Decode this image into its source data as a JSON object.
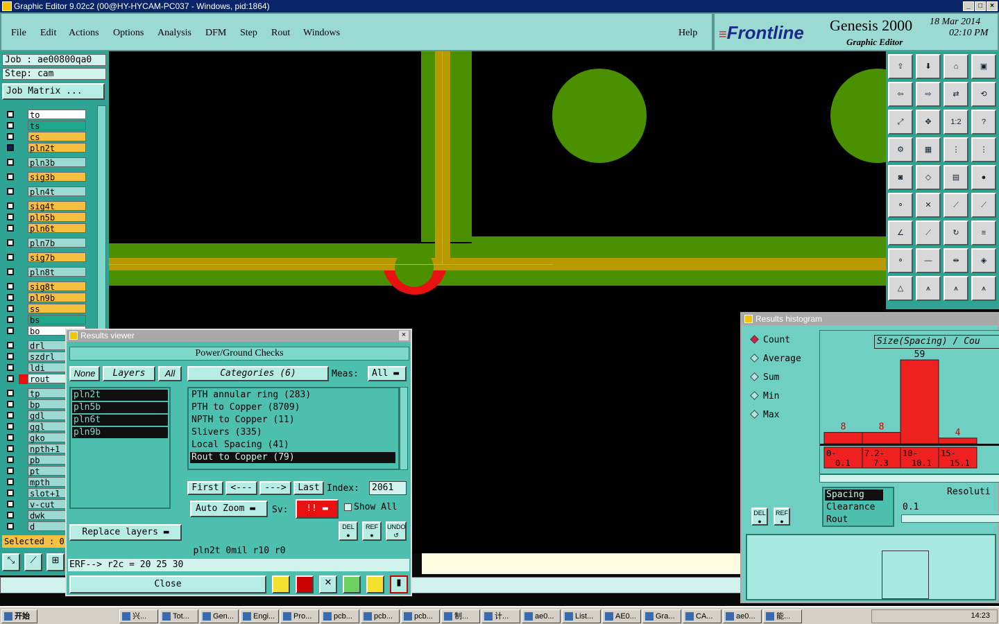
{
  "window": {
    "title": "Graphic Editor 9.02c2 (00@HY-HYCAM-PC037 - Windows, pid:1864)"
  },
  "menu": [
    "File",
    "Edit",
    "Actions",
    "Options",
    "Analysis",
    "DFM",
    "Step",
    "Rout",
    "Windows"
  ],
  "menu_help": "Help",
  "brand": {
    "logo": "Frontline",
    "product": "Genesis 2000",
    "subtitle": "Graphic Editor",
    "date": "18 Mar 2014",
    "time": "02:10 PM"
  },
  "job": {
    "job": "Job : ae00800qa0",
    "step": "Step: cam",
    "matrix": "Job Matrix ..."
  },
  "layers": [
    {
      "name": "to",
      "color": "#ffffff"
    },
    {
      "name": "ts",
      "color": "#1fa88c"
    },
    {
      "name": "cs",
      "color": "#f5c040"
    },
    {
      "name": "pln2t",
      "color": "#f5c040"
    },
    {
      "name": "pln3b",
      "color": "#9adad2"
    },
    {
      "name": "sig3b",
      "color": "#f5c040"
    },
    {
      "name": "pln4t",
      "color": "#9adad2"
    },
    {
      "name": "sig4t",
      "color": "#f5c040"
    },
    {
      "name": "pln5b",
      "color": "#f5c040"
    },
    {
      "name": "pln6t",
      "color": "#f5c040"
    },
    {
      "name": "pln7b",
      "color": "#9adad2"
    },
    {
      "name": "sig7b",
      "color": "#f5c040"
    },
    {
      "name": "pln8t",
      "color": "#9adad2"
    },
    {
      "name": "sig8t",
      "color": "#f5c040"
    },
    {
      "name": "pln9b",
      "color": "#f5c040"
    },
    {
      "name": "ss",
      "color": "#f5c040"
    },
    {
      "name": "bs",
      "color": "#1fa88c"
    },
    {
      "name": "bo",
      "color": "#ffffff"
    },
    {
      "name": "drl",
      "color": "#9adad2"
    },
    {
      "name": "szdrl",
      "color": "#9adad2"
    },
    {
      "name": "ldi",
      "color": "#9adad2"
    },
    {
      "name": "rout",
      "color": "#d2f2ee"
    },
    {
      "name": "tp",
      "color": "#9adad2"
    },
    {
      "name": "bp",
      "color": "#9adad2"
    },
    {
      "name": "gdl",
      "color": "#9adad2"
    },
    {
      "name": "ggl",
      "color": "#9adad2"
    },
    {
      "name": "gko",
      "color": "#9adad2"
    },
    {
      "name": "npth+1",
      "color": "#9adad2"
    },
    {
      "name": "pb",
      "color": "#9adad2"
    },
    {
      "name": "pt",
      "color": "#9adad2"
    },
    {
      "name": "mpth",
      "color": "#9adad2"
    },
    {
      "name": "slot+1",
      "color": "#9adad2"
    },
    {
      "name": "v-cut",
      "color": "#9adad2"
    },
    {
      "name": "dwk",
      "color": "#9adad2"
    },
    {
      "name": "d",
      "color": "#9adad2"
    }
  ],
  "selected": "Selected : 0",
  "results": {
    "title": "Results viewer",
    "header": "Power/Ground Checks",
    "none": "None",
    "layers": "Layers",
    "all": "All",
    "categories_btn": "Categories (6)",
    "meas": "Meas:",
    "meas_val": "All",
    "layer_list": [
      "pln2t",
      "pln5b",
      "pln6t",
      "pln9b"
    ],
    "category_list": [
      "PTH annular ring (283)",
      "PTH to Copper (8709)",
      "NPTH to Copper (11)",
      "Slivers (335)",
      "Local Spacing (41)",
      "Rout to Copper (79)"
    ],
    "first": "First",
    "prev": "<---",
    "next": "--->",
    "last": "Last",
    "index_label": "Index:",
    "index": "2061",
    "auto_zoom": "Auto Zoom",
    "sv": "Sv:",
    "sv_val": "!!",
    "show_all": "Show All",
    "replace": "Replace layers",
    "status": "pln2t 0mil r10 r0",
    "erf": "ERF--> r2c = 20 25 30",
    "close": "Close",
    "del": "DEL",
    "ref": "REF",
    "undo": "UNDO"
  },
  "histogram": {
    "title": "Results histogram",
    "modes": [
      "Count",
      "Average",
      "Sum",
      "Min",
      "Max"
    ],
    "chart_title": "Size(Spacing) / Cou",
    "types": [
      "Spacing",
      "Clearance",
      "Rout"
    ],
    "resolution_label": "Resoluti",
    "resolution": "0.1",
    "del": "DEL",
    "ref": "REF"
  },
  "chart_data": {
    "type": "bar",
    "categories": [
      "0-0.1",
      "7.2-7.3",
      "10-10.1",
      "15-15.1"
    ],
    "values": [
      8,
      8,
      59,
      4
    ],
    "title": "Size(Spacing) / Cou",
    "ylim": [
      0,
      60
    ]
  },
  "taskbar": {
    "start": "开始",
    "time": "14:23",
    "items": [
      "兴...",
      "Tot...",
      "Gen...",
      "Engi...",
      "Pro...",
      "pcb...",
      "pcb...",
      "pcb...",
      "制...",
      "计...",
      "ae0...",
      "List...",
      "AE0...",
      "Gra...",
      "CA...",
      "ae0...",
      "能..."
    ]
  }
}
